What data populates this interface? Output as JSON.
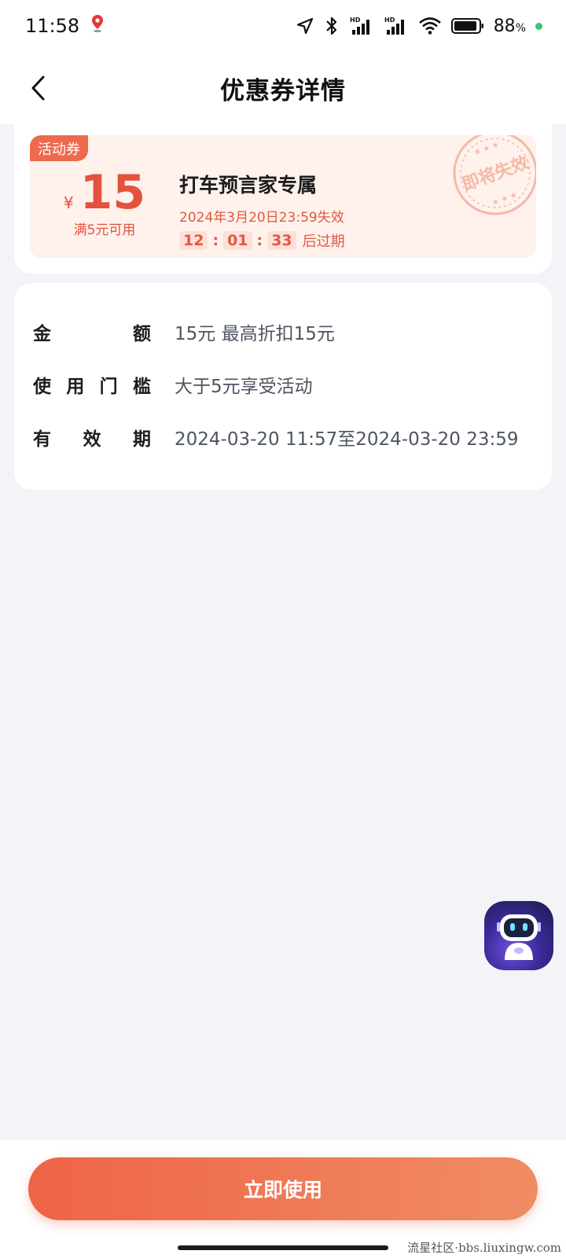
{
  "status_bar": {
    "time": "11:58",
    "battery": "88",
    "battery_unit": "%",
    "icons": [
      "location-pin-icon",
      "navigation-arrow-icon",
      "bluetooth-icon",
      "signal-hd-icon",
      "signal-hd-icon",
      "wifi-icon",
      "battery-icon"
    ],
    "hd_label": "HD"
  },
  "nav": {
    "back_icon": "chevron-left-icon",
    "title": "优惠券详情"
  },
  "coupon": {
    "tag": "活动券",
    "currency": "¥",
    "amount": "15",
    "threshold": "满5元可用",
    "name": "打车预言家专属",
    "expire_text": "2024年3月20日23:59失效",
    "countdown": {
      "hours": "12",
      "minutes": "01",
      "seconds": "33",
      "suffix": "后过期",
      "separator": ":"
    },
    "stamp_text": "即将失效",
    "colors": {
      "accent": "#e2523c",
      "tag_bg": "#ee6a4c",
      "card_bg": "#fff1ec"
    }
  },
  "details": {
    "rows": [
      {
        "label_chars": [
          "金",
          "额"
        ],
        "value": "15元 最高折扣15元"
      },
      {
        "label_chars": [
          "使",
          "用",
          "门",
          "槛"
        ],
        "value": "大于5元享受活动"
      },
      {
        "label_chars": [
          "有",
          "效",
          "期"
        ],
        "value": "2024-03-20 11:57至2024-03-20 23:59"
      }
    ]
  },
  "assistant": {
    "icon": "robot-assistant-icon"
  },
  "action": {
    "use_label": "立即使用",
    "colors": {
      "start": "#ee6446",
      "end": "#f08c64"
    }
  },
  "watermark": "流星社区·bbs.liuxingw.com"
}
